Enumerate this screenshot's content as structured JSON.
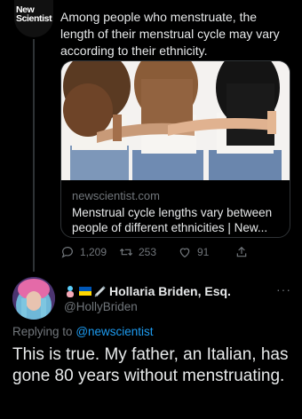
{
  "original_tweet": {
    "avatar_logo_line1": "New",
    "avatar_logo_line2": "Scientist",
    "text": "Among people who menstruate, the length of their menstrual cycle may vary according to their ethnicity.",
    "card": {
      "domain": "newscientist.com",
      "title": "Menstrual cycle lengths vary between people of different ethnicities | New..."
    },
    "actions": {
      "reply_count": "1,209",
      "retweet_count": "253",
      "like_count": "91"
    }
  },
  "reply_tweet": {
    "display_name": "Hollaria Briden, Esq.",
    "handle": "@HollyBriden",
    "replying_prefix": "Replying to",
    "replying_to": "@newscientist",
    "text": "This is true.  My father, an Italian, has gone 80 years without menstruating."
  }
}
